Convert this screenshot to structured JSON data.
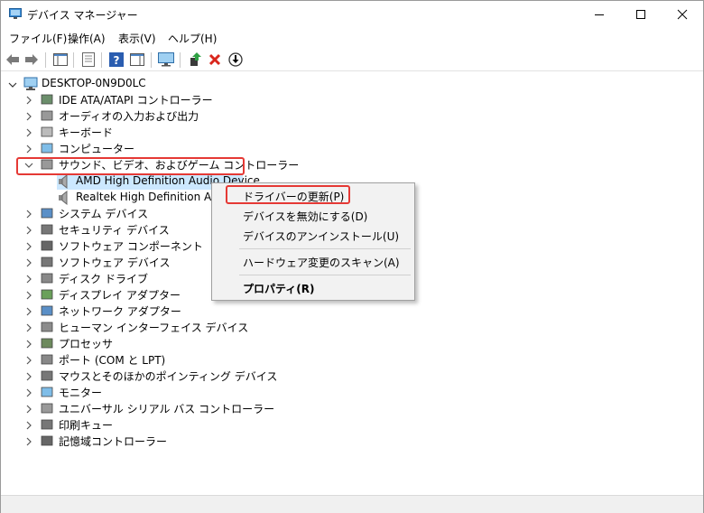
{
  "window": {
    "title": "デバイス マネージャー"
  },
  "menubar": {
    "items": [
      "ファイル(F)",
      "操作(A)",
      "表示(V)",
      "ヘルプ(H)"
    ]
  },
  "toolbar": {
    "buttons": [
      "back-arrow-icon",
      "forward-arrow-icon",
      "show-hide-console-tree-icon",
      "properties-icon",
      "help-icon",
      "action-pane-icon",
      "monitor-icon",
      "update-driver-icon",
      "uninstall-icon",
      "download-icon"
    ]
  },
  "tree": {
    "root": "DESKTOP-0N9D0LC",
    "categories": [
      "IDE ATA/ATAPI コントローラー",
      "オーディオの入力および出力",
      "キーボード",
      "コンピューター",
      "サウンド、ビデオ、およびゲーム コントローラー",
      "システム デバイス",
      "セキュリティ デバイス",
      "ソフトウェア コンポーネント",
      "ソフトウェア デバイス",
      "ディスク ドライブ",
      "ディスプレイ アダプター",
      "ネットワーク アダプター",
      "ヒューマン インターフェイス デバイス",
      "プロセッサ",
      "ポート (COM と LPT)",
      "マウスとそのほかのポインティング デバイス",
      "モニター",
      "ユニバーサル シリアル バス コントローラー",
      "印刷キュー",
      "記憶域コントローラー"
    ],
    "expanded_children": [
      "AMD High Definition Audio Device",
      "Realtek High Definition Audio"
    ]
  },
  "context_menu": {
    "items": [
      "ドライバーの更新(P)",
      "デバイスを無効にする(D)",
      "デバイスのアンインストール(U)",
      "ハードウェア変更のスキャン(A)",
      "プロパティ(R)"
    ]
  },
  "colors": {
    "highlight": "#e53935",
    "selection": "#cce8ff",
    "accent": "#1e73c8"
  }
}
